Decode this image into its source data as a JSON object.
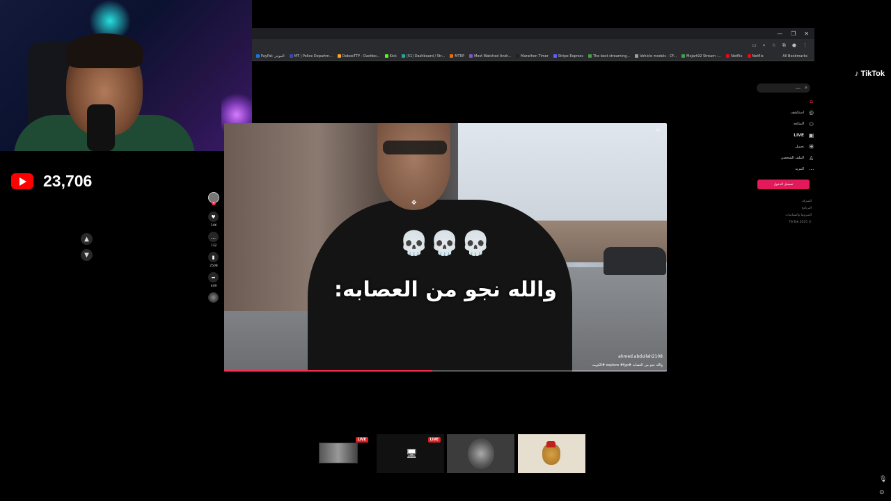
{
  "stream": {
    "subscriber_count": "23,706"
  },
  "browser": {
    "bookmarks": [
      {
        "label": "PayPal: الموجز",
        "color": "#1a73e8"
      },
      {
        "label": "MT | Police Departm...",
        "color": "#3949ab"
      },
      {
        "label": "DoboeTTP - Dashbo...",
        "color": "#f9a825"
      },
      {
        "label": "Kick",
        "color": "#53fc18"
      },
      {
        "label": "(51) Dashboard / Str...",
        "color": "#26a69a"
      },
      {
        "label": "MTRP",
        "color": "#ef6c00"
      },
      {
        "label": "Most Watched Andr...",
        "color": "#7e57c2"
      },
      {
        "label": "Marathon Timer",
        "color": "#222222"
      },
      {
        "label": "Stripe Express",
        "color": "#635bff"
      },
      {
        "label": "The best streaming...",
        "color": "#43a047"
      },
      {
        "label": "Vehicle models - CF...",
        "color": "#9e9e9e"
      },
      {
        "label": "Mejart92 Stream -...",
        "color": "#43a047"
      },
      {
        "label": "Netflix",
        "color": "#e50914"
      },
      {
        "label": "Netflix",
        "color": "#e50914"
      }
    ],
    "all_bookmarks_label": "All Bookmarks"
  },
  "tiktok": {
    "logo": "TikTok",
    "search_placeholder": "بحث",
    "nav": [
      {
        "label": "",
        "icon": "home-icon"
      },
      {
        "label": "استكشف",
        "icon": "compass-icon"
      },
      {
        "label": "المتابَعة",
        "icon": "following-icon"
      },
      {
        "label": "LIVE",
        "icon": "live-icon"
      },
      {
        "label": "تحميل",
        "icon": "upload-icon"
      },
      {
        "label": "الملف الشخصي",
        "icon": "profile-icon"
      },
      {
        "label": "المزيد",
        "icon": "more-icon"
      }
    ],
    "login_label": "تسجيل الدخول",
    "footer": [
      "الشركة",
      "البرنامج",
      "الشروط والسياسات",
      "TikTok 2025 ©"
    ],
    "accent_color": "#fe2c55"
  },
  "video": {
    "overlay_emoji": "💀💀💀",
    "caption": "والله نجو من العصابه:",
    "username": "ahmed.abdullah2108",
    "description": "والله نجو من العصابه #explore #fyp #الكويت",
    "progress": 0.47
  },
  "actions": {
    "likes": "14K",
    "comments": "132",
    "saves": "2508",
    "shares": "449"
  },
  "thumbnails": [
    {
      "live_label": "LIVE"
    },
    {
      "live_label": "LIVE"
    }
  ]
}
